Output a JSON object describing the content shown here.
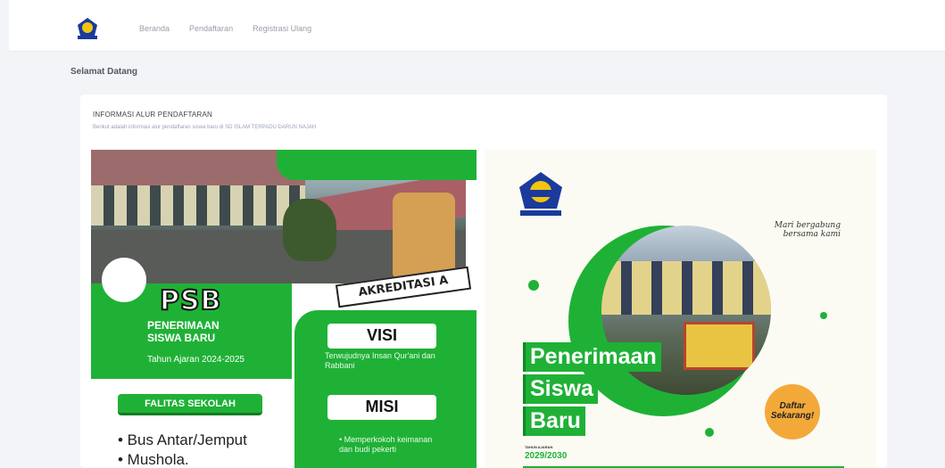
{
  "nav": {
    "logo_icon": "school-emblem-icon",
    "items": [
      "Beranda",
      "Pendaftaran",
      "Registrasi Ulang"
    ]
  },
  "page": {
    "welcome": "Selamat Datang"
  },
  "info": {
    "title": "INFORMASI ALUR PENDAFTARAN",
    "description": "Berikut adalah informasi alur pendaftaran siswa baru di SD ISLAM TERPADU DARUN NAJAH"
  },
  "poster_left": {
    "heading": "PSB",
    "subtitle_line1": "PENERIMAAN",
    "subtitle_line2": "SISWA BARU",
    "year": "Tahun Ajaran 2024-2025",
    "accreditation": "AKREDITASI A",
    "visi_label": "VISI",
    "visi_text": "Terwujudnya Insan Qur'ani dan Rabbani",
    "misi_label": "MISI",
    "misi_text": "• Memperkokoh keimanan dan budi pekerti",
    "fasilitas_label": "FALITAS SEKOLAH",
    "fasilitas": [
      "• Bus Antar/Jemput",
      "• Mushola."
    ]
  },
  "poster_right": {
    "invite": "Mari bergabung bersama kami",
    "words": [
      "Penerimaan",
      "Siswa",
      "Baru"
    ],
    "tahun_label": "TAHUN AJARAN",
    "tahun": "2029/2030",
    "cta": "Daftar Sekarang!"
  },
  "colors": {
    "green": "#1fb136",
    "orange": "#f3a93a",
    "background": "#f3f4f7"
  }
}
